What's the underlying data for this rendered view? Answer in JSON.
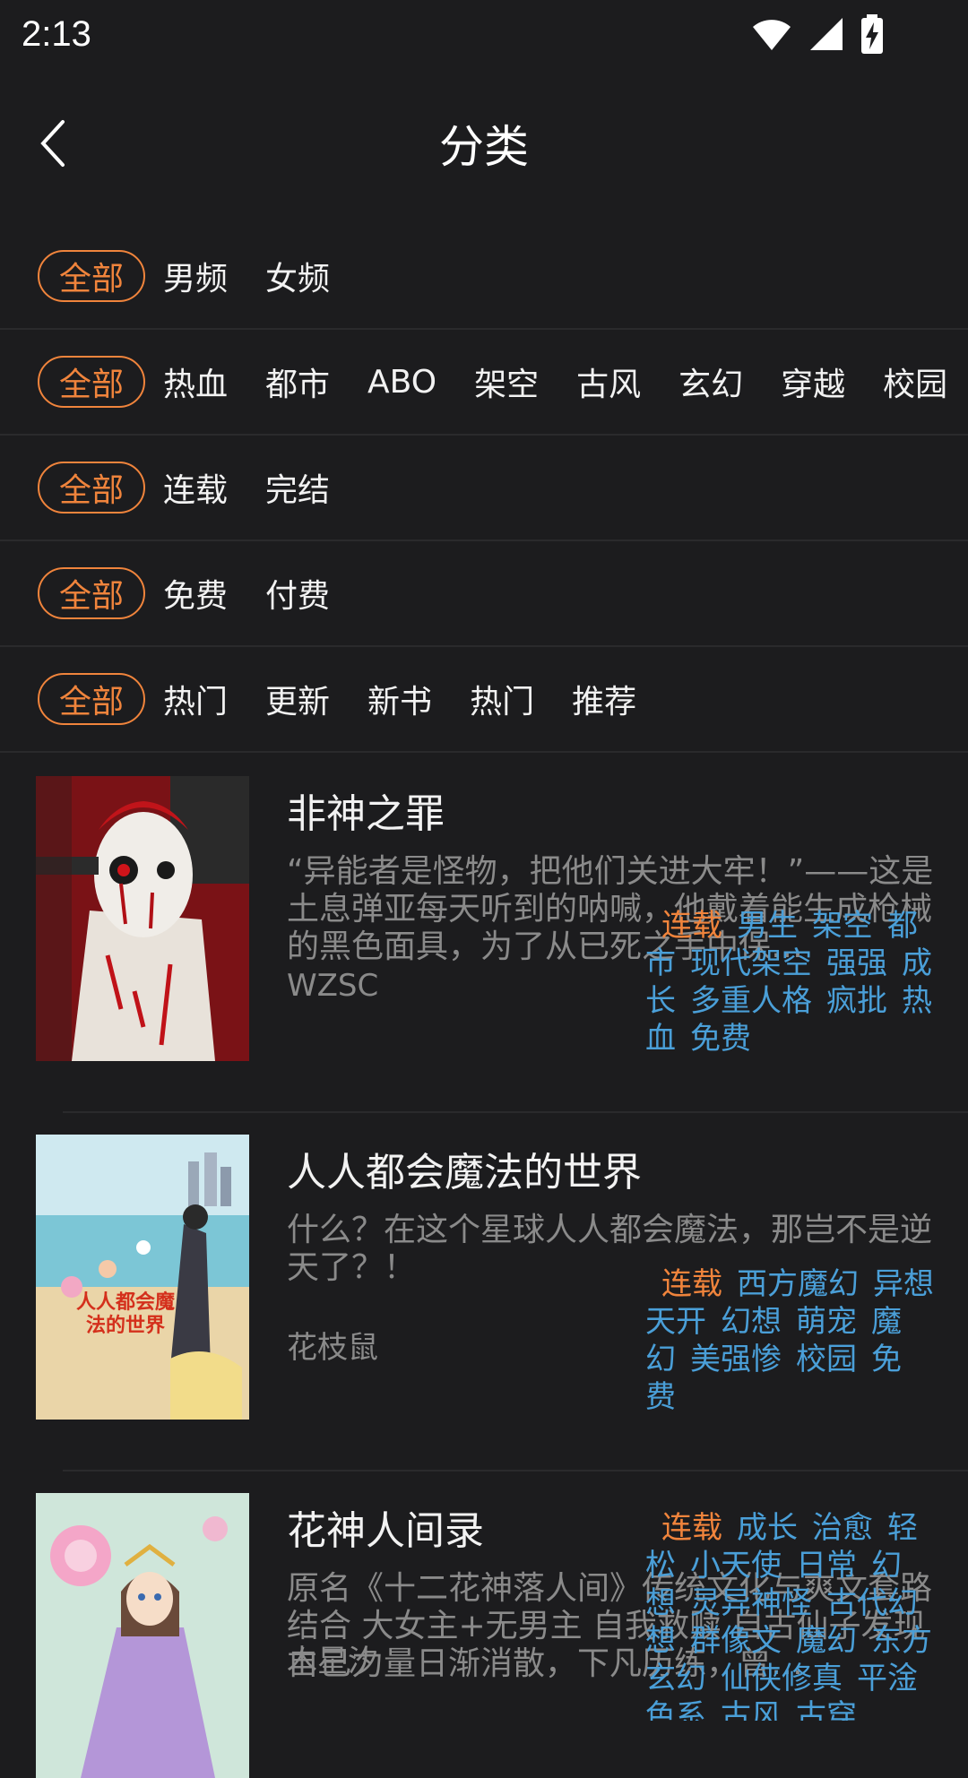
{
  "status": {
    "time": "2:13"
  },
  "header": {
    "title": "分类"
  },
  "filters": [
    {
      "selected": "全部",
      "options": [
        "男频",
        "女频"
      ]
    },
    {
      "selected": "全部",
      "options": [
        "热血",
        "都市",
        "ABO",
        "架空",
        "古风",
        "玄幻",
        "穿越",
        "校园"
      ]
    },
    {
      "selected": "全部",
      "options": [
        "连载",
        "完结"
      ]
    },
    {
      "selected": "全部",
      "options": [
        "免费",
        "付费"
      ]
    },
    {
      "selected": "全部",
      "options": [
        "热门",
        "更新",
        "新书",
        "热门",
        "推荐"
      ]
    }
  ],
  "books": [
    {
      "title": "非神之罪",
      "description": "“异能者是怪物，把他们关进大牢！”——这是土息弹亚每天听到的呐喊，他戴着能生成枪械的黑色面具，为了从已死之手中保…",
      "author": "WZSC",
      "status": "连载",
      "tags": [
        "男生",
        "架空",
        "都市",
        "现代架空",
        "强强",
        "成长",
        "多重人格",
        "疯批",
        "热血",
        "免费"
      ],
      "cover_colors": [
        "#8e1418",
        "#e9e4dc"
      ]
    },
    {
      "title": "人人都会魔法的世界",
      "description": "什么？在这个星球人人都会魔法，那岂不是逆天了？！",
      "author": "花枝鼠",
      "status": "连载",
      "tags": [
        "西方魔幻",
        "异想天开",
        "幻想",
        "萌宠",
        "魔幻",
        "美强惨",
        "校园",
        "免费"
      ],
      "cover_text": "人人都会魔法的世界",
      "cover_colors": [
        "#bfe3ea",
        "#e9d3a8"
      ]
    },
    {
      "title": "花神人间录",
      "description": "原名《十二花神落人间》传统文化与爽文套路结合 大女主+无男主 自我救赎 自古仙子发现自己力量日渐消散，下凡历练，曾…",
      "author": "木星汐",
      "status": "连载",
      "tags": [
        "成长",
        "治愈",
        "轻松",
        "小天使",
        "日常",
        "幻想",
        "灵异神怪",
        "古代幻想",
        "群像文",
        "魔幻",
        "东方玄幻",
        "仙侠修真",
        "平淦色系",
        "古风",
        "古穿"
      ],
      "cover_colors": [
        "#c9e2d3",
        "#b89ad8"
      ]
    }
  ]
}
